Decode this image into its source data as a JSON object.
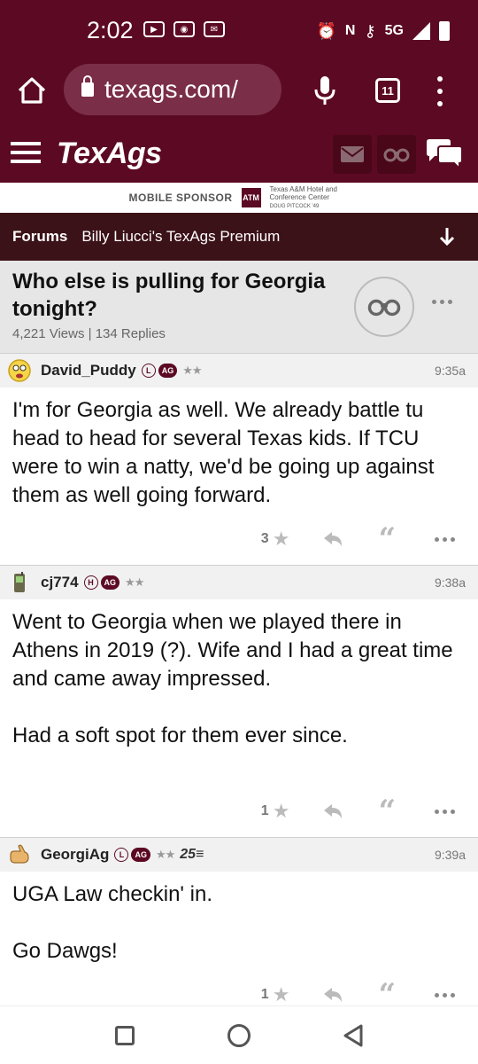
{
  "status_bar": {
    "time": "2:02",
    "network": "5G"
  },
  "browser": {
    "url": "texags.com/",
    "tab_count": "11"
  },
  "site": {
    "logo": "TexAgs"
  },
  "sponsor": {
    "label": "MOBILE SPONSOR",
    "logo_text": "ATM",
    "name": "Texas A&M Hotel and Conference Center",
    "sub": "DOUG PITCOCK '49"
  },
  "forum_bar": {
    "forums_label": "Forums",
    "board": "Billy Liucci's TexAgs Premium"
  },
  "thread": {
    "title": "Who else is pulling for Georgia tonight?",
    "views": "4,221 Views",
    "separator": "|",
    "replies": "134 Replies"
  },
  "posts": [
    {
      "username": "David_Puddy",
      "badge1": "L",
      "badge2": "AG",
      "stars": "★★",
      "extra": "",
      "time": "9:35a",
      "body": "I'm for Georgia as well. We already battle tu head to head for several Texas kids. If TCU were to win a natty, we'd be going up against them as well going forward.",
      "likes": "3"
    },
    {
      "username": "cj774",
      "badge1": "H",
      "badge2": "AG",
      "stars": "★★",
      "extra": "",
      "time": "9:38a",
      "body": "Went to Georgia when we played there in Athens in 2019 (?). Wife and I had a great time and came away impressed.\n\nHad a soft spot for them ever since.",
      "likes": "1"
    },
    {
      "username": "GeorgiAg",
      "badge1": "L",
      "badge2": "AG",
      "stars": "★★",
      "extra": "25",
      "time": "9:39a",
      "body": "UGA Law checkin' in.\n\nGo Dawgs!",
      "likes": "1"
    }
  ],
  "colors": {
    "maroon": "#5c0a24",
    "forum_bar": "#3b1218"
  }
}
